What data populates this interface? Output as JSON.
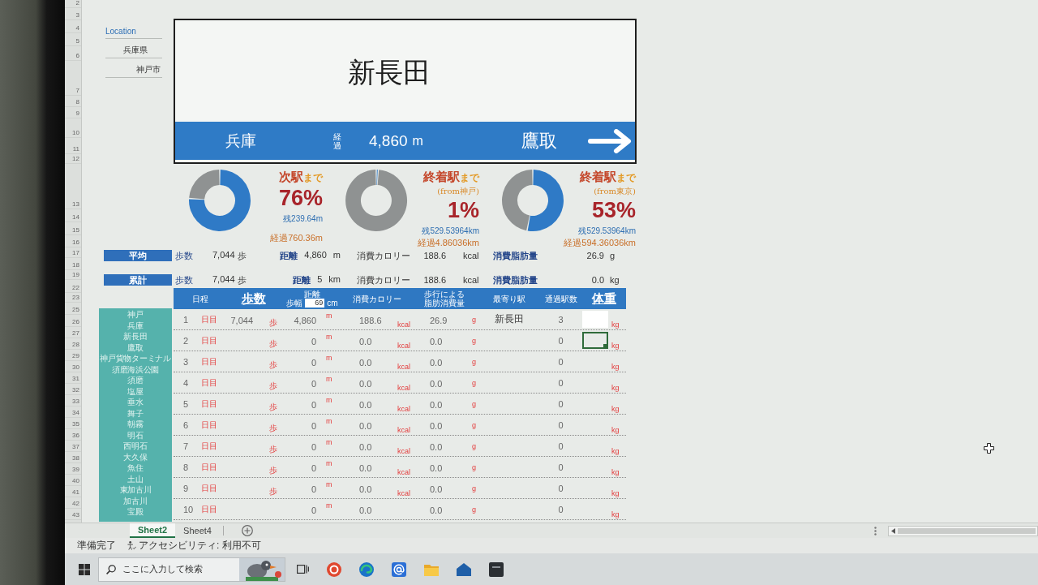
{
  "row_headers": [
    "2",
    "3",
    "4",
    "5",
    "6",
    "7",
    "8",
    "9",
    "10",
    "11",
    "12",
    "13",
    "14",
    "15",
    "16",
    "17",
    "18",
    "19",
    "22",
    "23",
    "25",
    "26",
    "27",
    "28",
    "29",
    "30",
    "31",
    "32",
    "33",
    "34",
    "35",
    "36",
    "37",
    "38",
    "39",
    "40",
    "41",
    "42",
    "43"
  ],
  "location": {
    "label": "Location",
    "items": [
      "兵庫県",
      "神戸市"
    ]
  },
  "station_sign": {
    "current": "新長田",
    "previous": "兵庫",
    "elapsed_label": "経過",
    "elapsed": "4,860",
    "elapsed_unit": "m",
    "next": "鷹取"
  },
  "gauges": [
    {
      "title": "次駅",
      "title_suffix": "まで",
      "chart_data": {
        "type": "donut",
        "values": [
          76,
          24
        ]
      },
      "percent": "76%",
      "remaining": "残239.64m",
      "elapsed": "経過760.36m"
    },
    {
      "title": "終着駅",
      "title_suffix": "まで",
      "origin": "(from神戸)",
      "chart_data": {
        "type": "donut",
        "values": [
          1,
          99
        ]
      },
      "percent": "1%",
      "remaining": "残529.53964km",
      "elapsed": "経過4.86036km"
    },
    {
      "title": "終着駅",
      "title_suffix": "まで",
      "origin": "(from東京)",
      "chart_data": {
        "type": "donut",
        "values": [
          53,
          47
        ]
      },
      "percent": "53%",
      "remaining": "残529.53964km",
      "elapsed": "経過594.36036km"
    }
  ],
  "summary": [
    {
      "label": "平均",
      "steps_label": "歩数",
      "steps": "7,044",
      "steps_unit": "歩",
      "distance_label": "距離",
      "distance": "4,860",
      "distance_unit": "m",
      "calories_label": "消費カロリー",
      "calories": "188.6",
      "calories_unit": "kcal",
      "fat_label": "消費脂肪量",
      "fat": "26.9",
      "fat_unit": "g"
    },
    {
      "label": "累計",
      "steps_label": "歩数",
      "steps": "7,044",
      "steps_unit": "歩",
      "distance_label": "距離",
      "distance": "5",
      "distance_unit": "km",
      "calories_label": "消費カロリー",
      "calories": "188.6",
      "calories_unit": "kcal",
      "fat_label": "消費脂肪量",
      "fat": "0.0",
      "fat_unit": "kg"
    }
  ],
  "station_list": [
    "神戸",
    "兵庫",
    "新長田",
    "鷹取",
    "神戸貨物ターミナル",
    "須磨海浜公園",
    "須磨",
    "塩屋",
    "垂水",
    "舞子",
    "朝霧",
    "明石",
    "西明石",
    "大久保",
    "魚住",
    "土山",
    "東加古川",
    "加古川",
    "宝殿"
  ],
  "table": {
    "columns": [
      {
        "label": "日程",
        "emphasis": false,
        "kind": "text"
      },
      {
        "label": "歩数",
        "emphasis": true,
        "kind": "text"
      },
      {
        "label": "距離",
        "emphasis": false,
        "kind": "stride"
      },
      {
        "label": "消費カロリー",
        "emphasis": false,
        "kind": "text"
      },
      {
        "label": "歩行による脂肪消費量",
        "emphasis": false,
        "kind": "text"
      },
      {
        "label": "最寄り駅",
        "emphasis": false,
        "kind": "text"
      },
      {
        "label": "通過駅数",
        "emphasis": false,
        "kind": "text"
      },
      {
        "label": "体重",
        "emphasis": true,
        "kind": "text"
      }
    ],
    "stride": {
      "label": "歩幅",
      "value": "69",
      "unit": "cm"
    },
    "rows": [
      {
        "day": "1",
        "day_unit": "日目",
        "steps": "7,044",
        "steps_unit": "歩",
        "distance": "4,860",
        "distance_unit": "m",
        "calories": "188.6",
        "calories_unit": "kcal",
        "fat": "26.9",
        "fat_unit": "g",
        "station": "新長田",
        "passed": "3",
        "weight_unit": "kg",
        "weight_highlighted": true,
        "weight_selected": false
      },
      {
        "day": "2",
        "day_unit": "日目",
        "steps_unit": "歩",
        "distance": "0",
        "distance_unit": "m",
        "calories": "0.0",
        "calories_unit": "kcal",
        "fat": "0.0",
        "fat_unit": "g",
        "passed": "0",
        "weight_unit": "kg",
        "weight_highlighted": false,
        "weight_selected": true
      },
      {
        "day": "3",
        "day_unit": "日目",
        "steps_unit": "歩",
        "distance": "0",
        "distance_unit": "m",
        "calories": "0.0",
        "calories_unit": "kcal",
        "fat": "0.0",
        "fat_unit": "g",
        "passed": "0",
        "weight_unit": "kg",
        "weight_highlighted": false,
        "weight_selected": false
      },
      {
        "day": "4",
        "day_unit": "日目",
        "steps_unit": "歩",
        "distance": "0",
        "distance_unit": "m",
        "calories": "0.0",
        "calories_unit": "kcal",
        "fat": "0.0",
        "fat_unit": "g",
        "passed": "0",
        "weight_unit": "kg",
        "weight_highlighted": false,
        "weight_selected": false
      },
      {
        "day": "5",
        "day_unit": "日目",
        "steps_unit": "歩",
        "distance": "0",
        "distance_unit": "m",
        "calories": "0.0",
        "calories_unit": "kcal",
        "fat": "0.0",
        "fat_unit": "g",
        "passed": "0",
        "weight_unit": "kg",
        "weight_highlighted": false,
        "weight_selected": false
      },
      {
        "day": "6",
        "day_unit": "日目",
        "steps_unit": "歩",
        "distance": "0",
        "distance_unit": "m",
        "calories": "0.0",
        "calories_unit": "kcal",
        "fat": "0.0",
        "fat_unit": "g",
        "passed": "0",
        "weight_unit": "kg",
        "weight_highlighted": false,
        "weight_selected": false
      },
      {
        "day": "7",
        "day_unit": "日目",
        "steps_unit": "歩",
        "distance": "0",
        "distance_unit": "m",
        "calories": "0.0",
        "calories_unit": "kcal",
        "fat": "0.0",
        "fat_unit": "g",
        "passed": "0",
        "weight_unit": "kg",
        "weight_highlighted": false,
        "weight_selected": false
      },
      {
        "day": "8",
        "day_unit": "日目",
        "steps_unit": "歩",
        "distance": "0",
        "distance_unit": "m",
        "calories": "0.0",
        "calories_unit": "kcal",
        "fat": "0.0",
        "fat_unit": "g",
        "passed": "0",
        "weight_unit": "kg",
        "weight_highlighted": false,
        "weight_selected": false
      },
      {
        "day": "9",
        "day_unit": "日目",
        "steps_unit": "歩",
        "distance": "0",
        "distance_unit": "m",
        "calories": "0.0",
        "calories_unit": "kcal",
        "fat": "0.0",
        "fat_unit": "g",
        "passed": "0",
        "weight_unit": "kg",
        "weight_highlighted": false,
        "weight_selected": false
      },
      {
        "day": "10",
        "day_unit": "日目",
        "distance": "0",
        "distance_unit": "m",
        "calories": "0.0",
        "fat": "0.0",
        "fat_unit": "g",
        "passed": "0",
        "weight_unit": "kg",
        "weight_highlighted": false,
        "weight_selected": false
      }
    ]
  },
  "sheet_tabs": [
    {
      "label": "Sheet2",
      "selected": true
    },
    {
      "label": "Sheet4",
      "selected": false
    }
  ],
  "status_bar": {
    "status": "準備完了",
    "accessibility": "アクセシビリティ: 利用不可"
  },
  "taskbar": {
    "search": {
      "placeholder": "ここに入力して検索"
    }
  }
}
